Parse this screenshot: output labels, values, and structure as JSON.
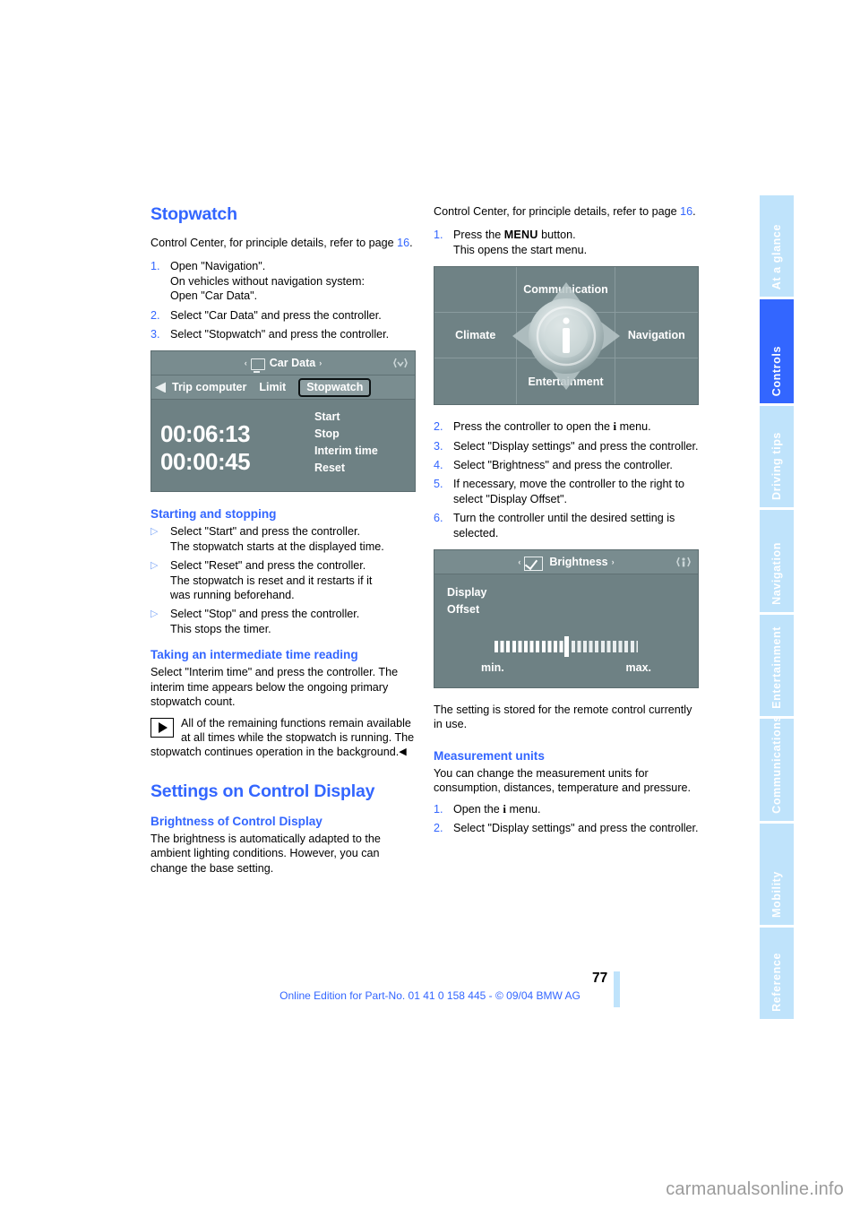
{
  "document": {
    "page_number": "77",
    "footer_line": "Online Edition for Part-No. 01 41 0 158 445 - © 09/04 BMW AG",
    "watermark": "carmanualsonline.info",
    "accent_color": "#3366ff",
    "tab_inactive_color": "#bfe3fb",
    "screen_color": "#6e8184"
  },
  "tabs": [
    {
      "label": "At a glance",
      "active": false
    },
    {
      "label": "Controls",
      "active": true
    },
    {
      "label": "Driving tips",
      "active": false
    },
    {
      "label": "Navigation",
      "active": false
    },
    {
      "label": "Entertainment",
      "active": false
    },
    {
      "label": "Communications",
      "active": false
    },
    {
      "label": "Mobility",
      "active": false
    },
    {
      "label": "Reference",
      "active": false
    }
  ],
  "left_column": {
    "section_title": "Stopwatch",
    "intro_a": "Control Center, for principle details, refer to",
    "intro_b": "page ",
    "intro_page_ref": "16",
    "intro_c": ".",
    "steps": [
      {
        "num": "1.",
        "text": "Open \"Navigation\".\nOn vehicles without navigation system:\nOpen \"Car Data\"."
      },
      {
        "num": "2.",
        "text": "Select \"Car Data\" and press the controller."
      },
      {
        "num": "3.",
        "text": "Select \"Stopwatch\" and press the controller."
      }
    ],
    "figure_car_data": {
      "title": "Car Data",
      "monitor_icon": "monitor-icon",
      "arrow_left": "‹",
      "arrow_right": "›",
      "tabs": [
        "Trip computer",
        "Limit",
        "Stopwatch"
      ],
      "selected_tab": "Stopwatch",
      "time_primary": "00:06:13",
      "time_interim": "00:00:45",
      "menu_items": [
        "Start",
        "Stop",
        "Interim time",
        "Reset"
      ]
    },
    "subsection_1": {
      "title": "Starting and stopping",
      "bullets": [
        "Select \"Start\" and press the controller.\nThe stopwatch starts at the displayed time.",
        "Select \"Reset\" and press the controller.\nThe stopwatch is reset and it restarts if it\nwas running beforehand.",
        "Select \"Stop\" and press the controller.\nThis stops the timer."
      ]
    },
    "subsection_2": {
      "title": "Taking an intermediate time reading",
      "paragraph": "Select \"Interim time\" and press the controller. The interim time appears below the ongoing primary stopwatch count.",
      "note_text": "All of the remaining functions remain available at all times while the stopwatch is running. The stopwatch continues operation in the background.",
      "note_end_marker": "◀"
    },
    "section_title_2": "Settings on Control Display",
    "subsection_3": {
      "title": "Brightness of Control Display",
      "paragraph": "The brightness is automatically adapted to the ambient lighting conditions. However, you can change the base setting."
    }
  },
  "right_column": {
    "intro_a": "Control Center, for principle details, refer to",
    "intro_b": "page ",
    "intro_page_ref": "16",
    "intro_c": ".",
    "step_1": {
      "num": "1.",
      "pre": "Press the ",
      "key": "MENU",
      "post": " button.",
      "line2": "This opens the start menu."
    },
    "figure_start_menu": {
      "cells": [
        "",
        "Communication",
        "",
        "Climate",
        "",
        "Navigation",
        "",
        "Entertainment",
        ""
      ],
      "center_icon": "info-knob-icon"
    },
    "step_2": {
      "num": "2.",
      "pre": "Press the controller to open the ",
      "key": "i",
      "post": " menu."
    },
    "steps_rest": [
      {
        "num": "3.",
        "text": "Select \"Display settings\" and press the controller."
      },
      {
        "num": "4.",
        "text": "Select \"Brightness\" and press the controller."
      },
      {
        "num": "5.",
        "text": "If necessary, move the controller to the right to select \"Display Offset\"."
      },
      {
        "num": "6.",
        "text": "Turn the controller until the desired setting is selected."
      }
    ],
    "figure_brightness": {
      "title": "Brightness",
      "check_icon": "checkmark-box-icon",
      "arrow_left": "‹",
      "arrow_right": "›",
      "labels": [
        "Display",
        "Offset"
      ],
      "slider_min_label": "min.",
      "slider_max_label": "max.",
      "slider_value_percent": 50
    },
    "after_figure_paragraph": "The setting is stored for the remote control currently in use.",
    "subsection_units": {
      "title": "Measurement units",
      "paragraph": "You can change the measurement units for consumption, distances, temperature and pressure.",
      "steps": [
        {
          "num": "1.",
          "pre": "Open the ",
          "key": "i",
          "post": " menu."
        },
        {
          "num": "2.",
          "pre": "Select \"Display settings\" and press the controller.",
          "key": "",
          "post": ""
        }
      ]
    }
  }
}
